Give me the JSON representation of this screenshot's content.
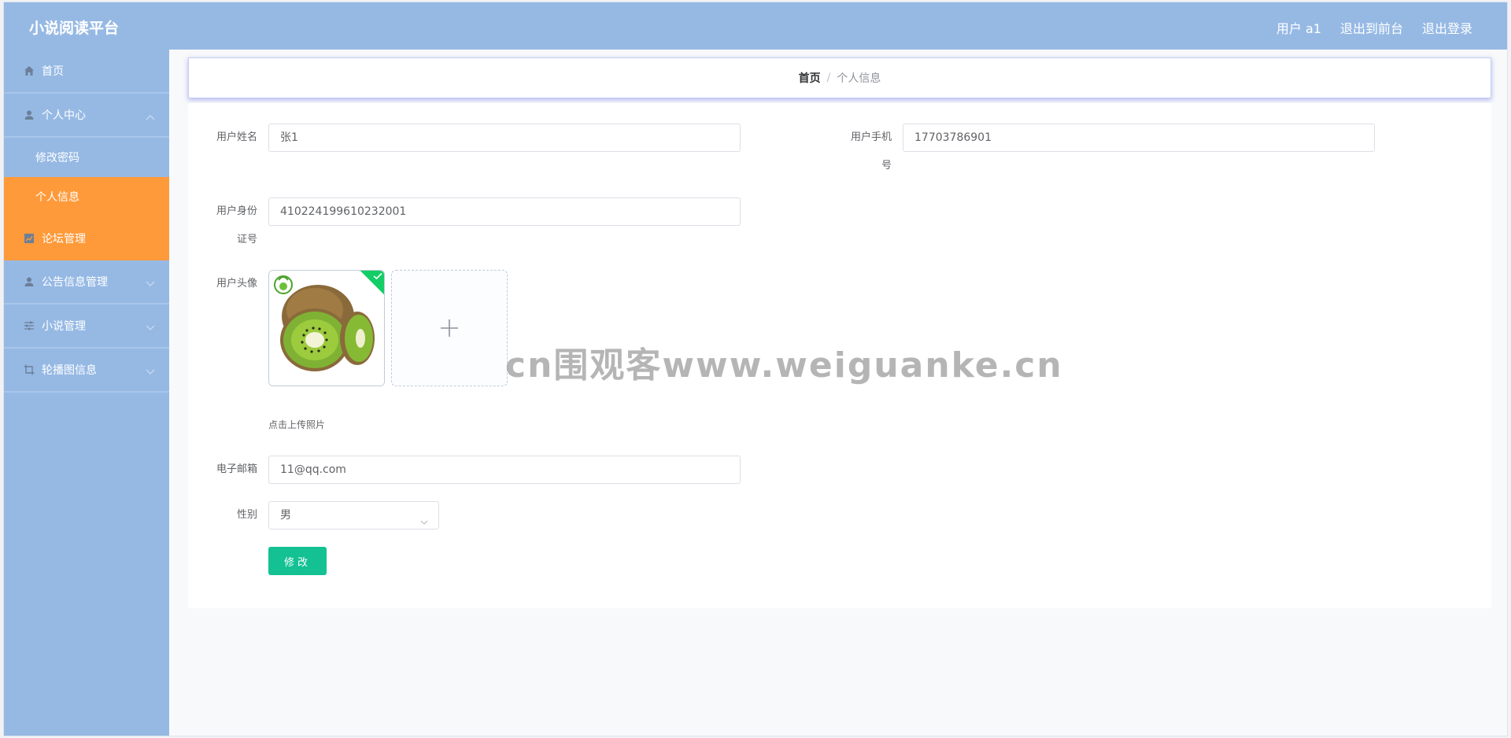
{
  "header": {
    "title": "小说阅读平台",
    "links": [
      "用户 a1",
      "退出到前台",
      "退出登录"
    ]
  },
  "sidebar": {
    "items": [
      {
        "label": "首页",
        "icon": "home-icon"
      },
      {
        "label": "个人中心",
        "icon": "user-icon",
        "expanded": true,
        "children": [
          {
            "label": "修改密码"
          },
          {
            "label": "个人信息",
            "active": true
          }
        ]
      },
      {
        "label": "论坛管理",
        "icon": "chart-icon"
      },
      {
        "label": "公告信息管理",
        "icon": "user-icon"
      },
      {
        "label": "小说管理",
        "icon": "sliders-icon"
      },
      {
        "label": "轮播图信息",
        "icon": "crop-icon"
      }
    ]
  },
  "breadcrumb": {
    "home": "首页",
    "separator": "/",
    "current": "个人信息"
  },
  "form": {
    "name_label": "用户姓名",
    "name_value": "张1",
    "phone_label_line1": "用户手机",
    "phone_label_line2": "号",
    "phone_value": "17703786901",
    "idcard_label_line1": "用户身份",
    "idcard_label_line2": "证号",
    "idcard_value": "410224199610232001",
    "avatar_label": "用户头像",
    "avatar_hint": "点击上传照片",
    "email_label": "电子邮箱",
    "email_value": "11@qq.com",
    "gender_label": "性别",
    "gender_value": "男",
    "submit_label": "修改"
  },
  "watermark": "cn围观客www.weiguanke.cn",
  "colors": {
    "header_bg": "#96b9e4",
    "active_menu_bg": "#fe9a3a",
    "submit_bg": "#13c193",
    "upload_success": "#13ce66"
  }
}
